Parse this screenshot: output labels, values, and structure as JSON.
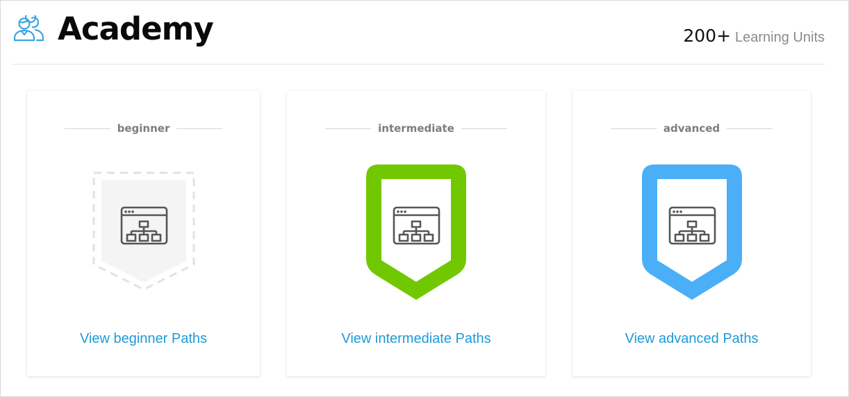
{
  "header": {
    "logo_icon": "users-icon",
    "title": "Academy",
    "count": "200+",
    "count_label": "Learning Units"
  },
  "colors": {
    "logo": "#3aa6e0",
    "link": "#1e9bd7",
    "intermediate_badge": "#72c800",
    "advanced_badge": "#4aaff7",
    "beginner_badge_fill": "#f4f4f4",
    "beginner_badge_border": "#e2e2e2",
    "icon_stroke": "#555555"
  },
  "cards": [
    {
      "level": "beginner",
      "badge_style": "dashed-empty",
      "badge_icon": "sitemap-browser-icon",
      "link": "View beginner Paths"
    },
    {
      "level": "intermediate",
      "badge_style": "green",
      "badge_icon": "sitemap-browser-icon",
      "link": "View intermediate Paths"
    },
    {
      "level": "advanced",
      "badge_style": "blue",
      "badge_icon": "sitemap-browser-icon",
      "link": "View advanced Paths"
    }
  ]
}
